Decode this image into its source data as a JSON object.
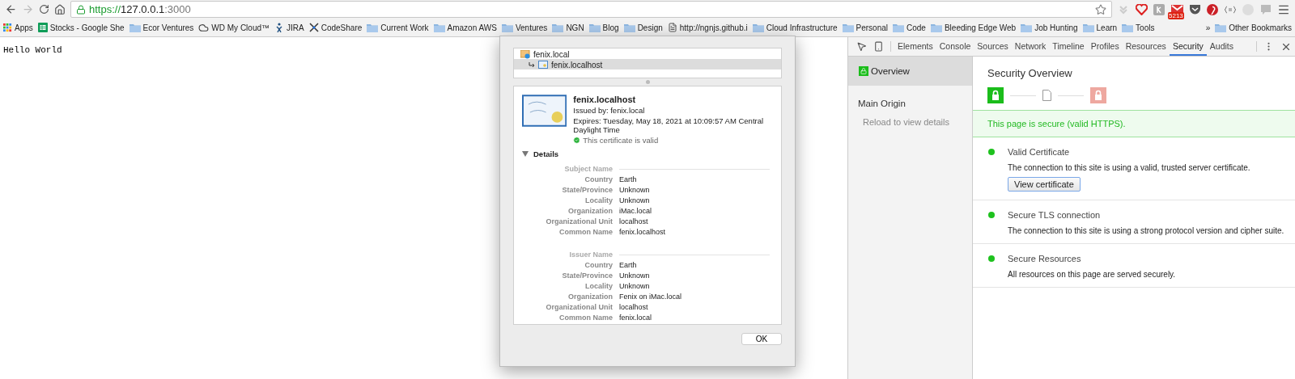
{
  "toolbar": {
    "url": {
      "scheme": "https://",
      "host": "127.0.0.1",
      "port": ":3000"
    },
    "extensions": [
      {
        "kind": "pocket-down"
      },
      {
        "kind": "heart"
      },
      {
        "kind": "tile"
      },
      {
        "kind": "mail",
        "badge": "5213"
      },
      {
        "kind": "pocket"
      },
      {
        "kind": "pin"
      },
      {
        "kind": "braces"
      },
      {
        "kind": "circle"
      },
      {
        "kind": "chat"
      }
    ]
  },
  "bookmarks": [
    {
      "kind": "apps",
      "label": "Apps"
    },
    {
      "kind": "sheet",
      "label": "Stocks - Google She"
    },
    {
      "kind": "folder",
      "label": "Ecor Ventures"
    },
    {
      "kind": "cloud",
      "label": "WD My Cloud™"
    },
    {
      "kind": "jira",
      "label": "JIRA"
    },
    {
      "kind": "codeshare",
      "label": "CodeShare"
    },
    {
      "kind": "folder",
      "label": "Current Work"
    },
    {
      "kind": "folder",
      "label": "Amazon AWS"
    },
    {
      "kind": "folder",
      "label": "Ventures"
    },
    {
      "kind": "folder",
      "label": "NGN"
    },
    {
      "kind": "folder",
      "label": "Blog"
    },
    {
      "kind": "folder",
      "label": "Design"
    },
    {
      "kind": "page",
      "label": "http://ngnjs.github.i"
    },
    {
      "kind": "folder",
      "label": "Cloud Infrastructure"
    },
    {
      "kind": "folder",
      "label": "Personal"
    },
    {
      "kind": "folder",
      "label": "Code"
    },
    {
      "kind": "folder",
      "label": "Bleeding Edge Web"
    },
    {
      "kind": "folder",
      "label": "Job Hunting"
    },
    {
      "kind": "folder",
      "label": "Learn"
    },
    {
      "kind": "folder",
      "label": "Tools"
    },
    {
      "kind": "more",
      "label": "»"
    },
    {
      "kind": "folder",
      "label": "Other Bookmarks"
    }
  ],
  "page": {
    "text": "Hello World"
  },
  "certificate_dialog": {
    "tree": [
      {
        "label": "fenix.local",
        "kind": "root",
        "selected": false,
        "children": [
          {
            "label": "fenix.localhost",
            "kind": "leaf",
            "selected": true
          }
        ]
      }
    ],
    "certificate": {
      "name": "fenix.localhost",
      "issued_by": "Issued by: fenix.local",
      "expires": "Expires: Tuesday, May 18, 2021 at 10:09:57 AM Central Daylight Time",
      "status": "This certificate is valid",
      "valid": true
    },
    "details": {
      "label": "Details",
      "expanded": true,
      "sections": [
        {
          "heading": "Subject Name",
          "rows": [
            {
              "label": "Country",
              "value": "Earth"
            },
            {
              "label": "State/Province",
              "value": "Unknown"
            },
            {
              "label": "Locality",
              "value": "Unknown"
            },
            {
              "label": "Organization",
              "value": "iMac.local"
            },
            {
              "label": "Organizational Unit",
              "value": "localhost"
            },
            {
              "label": "Common Name",
              "value": "fenix.localhost"
            }
          ]
        },
        {
          "heading": "Issuer Name",
          "rows": [
            {
              "label": "Country",
              "value": "Earth"
            },
            {
              "label": "State/Province",
              "value": "Unknown"
            },
            {
              "label": "Locality",
              "value": "Unknown"
            },
            {
              "label": "Organization",
              "value": "Fenix on iMac.local"
            },
            {
              "label": "Organizational Unit",
              "value": "localhost"
            },
            {
              "label": "Common Name",
              "value": "fenix.local"
            }
          ]
        }
      ]
    },
    "ok_button": "OK"
  },
  "devtools": {
    "tabs": [
      {
        "label": "Elements",
        "selected": false
      },
      {
        "label": "Console",
        "selected": false
      },
      {
        "label": "Sources",
        "selected": false
      },
      {
        "label": "Network",
        "selected": false
      },
      {
        "label": "Timeline",
        "selected": false
      },
      {
        "label": "Profiles",
        "selected": false
      },
      {
        "label": "Resources",
        "selected": false
      },
      {
        "label": "Security",
        "selected": true
      },
      {
        "label": "Audits",
        "selected": false
      }
    ],
    "sidebar": {
      "overview": {
        "label": "Overview",
        "selected": true
      },
      "origin_heading": "Main Origin",
      "origin_hint": "Reload to view details"
    },
    "main": {
      "title": "Security Overview",
      "summary": "This page is secure (valid HTTPS).",
      "items": [
        {
          "color": "#1ec21e",
          "title": "Valid Certificate",
          "description": "The connection to this site is using a valid, trusted server certificate.",
          "button": "View certificate"
        },
        {
          "color": "#1ec21e",
          "title": "Secure TLS connection",
          "description": "The connection to this site is using a strong protocol version and cipher suite."
        },
        {
          "color": "#1ec21e",
          "title": "Secure Resources",
          "description": "All resources on this page are served securely."
        }
      ]
    }
  }
}
